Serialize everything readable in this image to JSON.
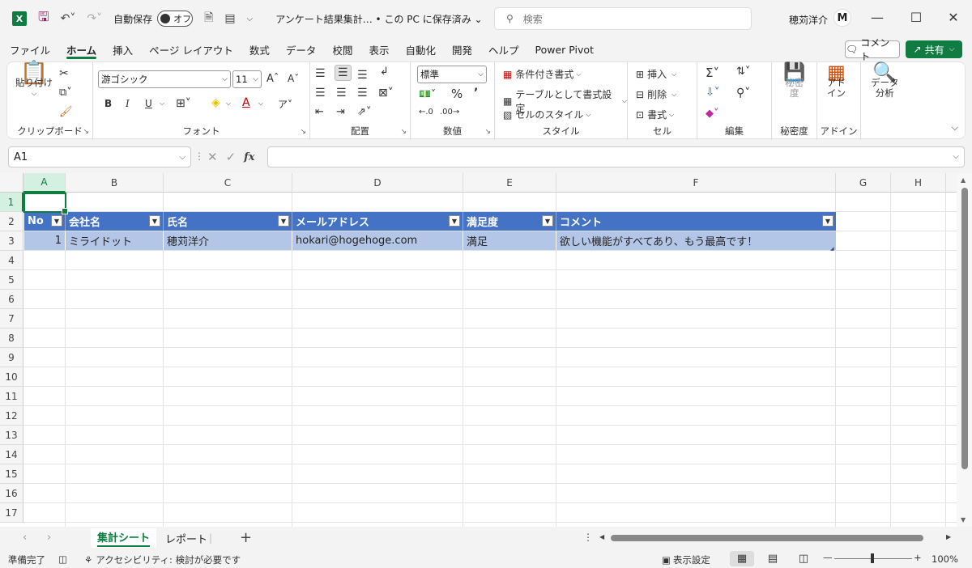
{
  "titlebar": {
    "app_logo": "X",
    "autosave_label": "自動保存",
    "autosave_state": "オフ",
    "doc_title": "アンケート結果集計… • この PC に保存済み ⌄",
    "search_placeholder": "検索",
    "user_name": "穂苅洋介",
    "avatar_letter": "M"
  },
  "menu": {
    "tabs": [
      "ファイル",
      "ホーム",
      "挿入",
      "ページ レイアウト",
      "数式",
      "データ",
      "校閲",
      "表示",
      "自動化",
      "開発",
      "ヘルプ",
      "Power Pivot"
    ],
    "active": "ホーム",
    "comment_label": "コメント",
    "share_label": "共有"
  },
  "ribbon": {
    "clipboard": {
      "label": "クリップボード",
      "paste": "貼り付け"
    },
    "font": {
      "label": "フォント",
      "font_name": "游ゴシック",
      "font_size": "11"
    },
    "alignment": {
      "label": "配置"
    },
    "number": {
      "label": "数値",
      "format": "標準"
    },
    "styles": {
      "label": "スタイル",
      "conditional": "条件付き書式",
      "table_format": "テーブルとして書式設定",
      "cell_styles": "セルのスタイル"
    },
    "cells": {
      "label": "セル",
      "insert": "挿入",
      "delete": "削除",
      "format": "書式"
    },
    "editing": {
      "label": "編集"
    },
    "sensitivity": {
      "label": "秘密度",
      "button": "秘密度"
    },
    "addins": {
      "label": "アドイン",
      "button": "アド\nイン"
    },
    "analysis": {
      "button_line1": "データ",
      "button_line2": "分析"
    }
  },
  "formula_bar": {
    "name_box": "A1",
    "fx": "fx",
    "content": ""
  },
  "grid": {
    "columns": [
      "A",
      "B",
      "C",
      "D",
      "E",
      "F",
      "G",
      "H"
    ],
    "rows": [
      "1",
      "2",
      "3",
      "4",
      "5",
      "6",
      "7",
      "8",
      "9",
      "10",
      "11",
      "12",
      "13",
      "14",
      "15",
      "16",
      "17"
    ],
    "table_headers": [
      "No",
      "会社名",
      "氏名",
      "メールアドレス",
      "満足度",
      "コメント"
    ],
    "table_rows": [
      [
        "1",
        "ミライドット",
        "穂苅洋介",
        "hokari@hogehoge.com",
        "満足",
        "欲しい機能がすべてあり、もう最高です！"
      ]
    ]
  },
  "sheets": {
    "tabs": [
      "集計シート",
      "レポート"
    ],
    "active": "集計シート"
  },
  "status": {
    "ready": "準備完了",
    "accessibility": "アクセシビリティ: 検討が必要です",
    "display_settings": "表示設定",
    "zoom": "100%"
  },
  "colors": {
    "accent": "#107c41",
    "table_header": "#4472c4",
    "table_row": "#b4c6e7"
  }
}
